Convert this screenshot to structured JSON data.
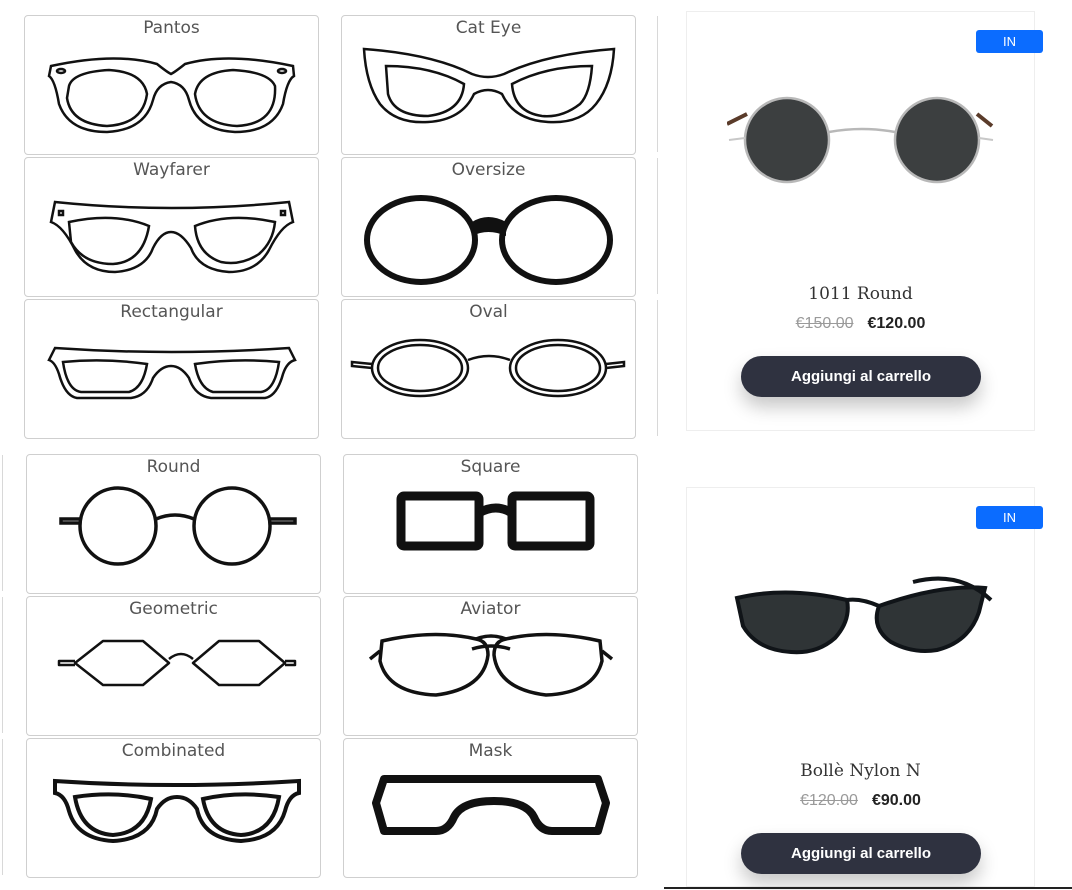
{
  "shapes": [
    {
      "label": "Pantos",
      "icon": "pantos-glasses-icon"
    },
    {
      "label": "Cat Eye",
      "icon": "cat-eye-glasses-icon"
    },
    {
      "label": "Wayfarer",
      "icon": "wayfarer-glasses-icon"
    },
    {
      "label": "Oversize",
      "icon": "oversize-glasses-icon"
    },
    {
      "label": "Rectangular",
      "icon": "rectangular-glasses-icon"
    },
    {
      "label": "Oval",
      "icon": "oval-glasses-icon"
    },
    {
      "label": "Round",
      "icon": "round-glasses-icon"
    },
    {
      "label": "Square",
      "icon": "square-glasses-icon"
    },
    {
      "label": "Geometric",
      "icon": "geometric-glasses-icon"
    },
    {
      "label": "Aviator",
      "icon": "aviator-glasses-icon"
    },
    {
      "label": "Combinated",
      "icon": "combinated-glasses-icon"
    },
    {
      "label": "Mask",
      "icon": "mask-glasses-icon"
    }
  ],
  "products": [
    {
      "badge": "IN",
      "name": "1011 Round",
      "old_price": "€150.00",
      "price": "€120.00",
      "button": "Aggiungi al carrello"
    },
    {
      "badge": "IN",
      "name": "Bollè Nylon N",
      "old_price": "€120.00",
      "price": "€90.00",
      "button": "Aggiungi al carrello"
    }
  ],
  "colors": {
    "badge": "#0b6cff",
    "button": "#2f3240"
  }
}
